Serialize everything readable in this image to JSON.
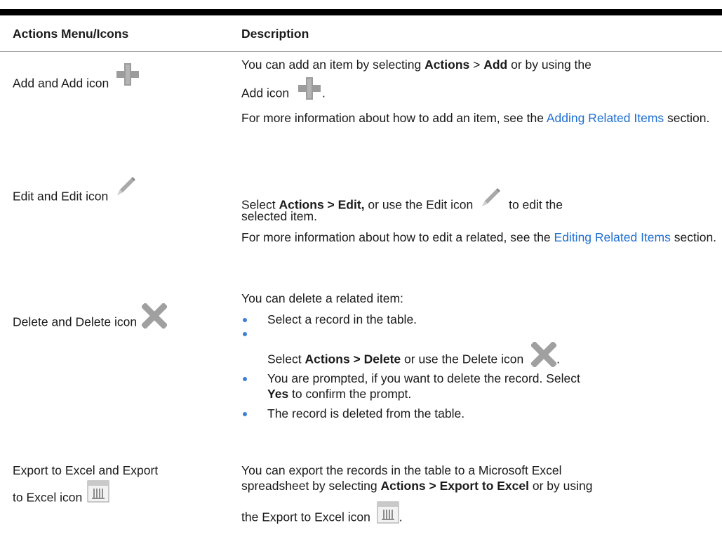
{
  "table": {
    "headers": [
      "Actions Menu/Icons",
      "Description"
    ],
    "rows": {
      "add": {
        "name": "Add and Add icon",
        "desc1_pre": "You can add an item by selecting ",
        "desc1_b1": "Actions",
        "desc1_mid": " > ",
        "desc1_b2": "Add",
        "desc1_post": " or by using the",
        "desc2_pre": "Add icon",
        "desc2_post": ".",
        "desc3_pre": "For more information about how to add an item, see the ",
        "desc3_link": "Adding Related Items",
        "desc3_post": " section."
      },
      "edit": {
        "name": "Edit and Edit icon",
        "desc1_pre": "Select ",
        "desc1_b": "Actions > Edit,",
        "desc1_mid": " or use the Edit icon",
        "desc1_post": "to edit the",
        "desc1_cont": "selected item.",
        "desc2_pre": "For more information about how to edit a related, see the ",
        "desc2_link": "Editing Related Items",
        "desc2_post": " section."
      },
      "delete": {
        "name": "Delete and Delete icon",
        "intro": "You can delete a related item:",
        "b1": "Select a record in the table.",
        "b2_pre": "Select ",
        "b2_b": "Actions > Delete",
        "b2_mid": " or use the Delete icon",
        "b2_post": ".",
        "b3_pre": "You are prompted, if you want to delete the record. Select",
        "b3_b": "Yes",
        "b3_post": " to confirm the prompt.",
        "b4": "The record is deleted from the table."
      },
      "export": {
        "name_l1": "Export to Excel and Export",
        "name_l2": "to Excel icon",
        "desc1": "You can export the records in the table to a Microsoft Excel",
        "desc2_pre": "spreadsheet by selecting ",
        "desc2_b": "Actions > Export to Excel",
        "desc2_post": " or by using",
        "desc3_pre": "the Export to Excel icon",
        "desc3_post": "."
      }
    }
  },
  "icons": {
    "add": "plus-icon",
    "edit": "pencil-icon",
    "delete": "x-icon",
    "export": "spreadsheet-icon"
  },
  "colors": {
    "link": "#1f6fd1",
    "bullet": "#3f7fd6",
    "icon_gray": "#9c9c9c"
  }
}
